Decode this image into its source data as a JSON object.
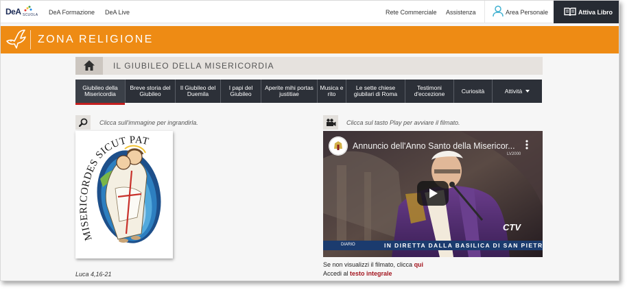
{
  "topnav": {
    "logo_brand": "DeA",
    "logo_sub": "SCUOLA",
    "links": [
      "DeA Formazione",
      "DeA Live"
    ],
    "right_links": [
      "Rete Commerciale",
      "Assistenza"
    ],
    "area_personale": "Area Personale",
    "attiva_libro": "Attiva Libro"
  },
  "banner": {
    "title": "ZONA RELIGIONE",
    "color": "#ee8b14"
  },
  "section": {
    "title": "IL GIUBILEO DELLA MISERICORDIA"
  },
  "tabs": [
    {
      "label": "Giubileo della Misericordia",
      "active": true
    },
    {
      "label": "Breve storia del Giubileo",
      "active": false
    },
    {
      "label": "Il Giubileo del Duemila",
      "active": false
    },
    {
      "label": "I papi del Giubileo",
      "active": false
    },
    {
      "label": "Aperite mihi portas justitiae",
      "active": false
    },
    {
      "label": "Musica e rito",
      "active": false
    },
    {
      "label": "Le sette chiese giubilari di Roma",
      "active": false
    },
    {
      "label": "Testimoni d'eccezione",
      "active": false
    },
    {
      "label": "Curiosità",
      "active": false
    },
    {
      "label": "Attività",
      "active": false
    }
  ],
  "left": {
    "hint": "Clicca sull'immagine per ingrandirla.",
    "logo_motto": "MISERICORDES SICUT PATER",
    "citation": "Luca 4,16-21"
  },
  "right": {
    "hint": "Clicca sul tasto Play per avviare il filmato.",
    "video": {
      "title": "Annuncio dell'Anno Santo della Misericor...",
      "corner_tag": "LV2000",
      "ticker": "IN DIRETTA DALLA BASILICA DI SAN PIETRO LA LITU",
      "ticker_label": "DIARIO",
      "watermark": "CTV"
    },
    "fallback_prefix": "Se non visualizzi il filmato, clicca ",
    "fallback_link": "qui",
    "full_text_prefix": "Accedi al ",
    "full_text_link": "testo integrale"
  }
}
